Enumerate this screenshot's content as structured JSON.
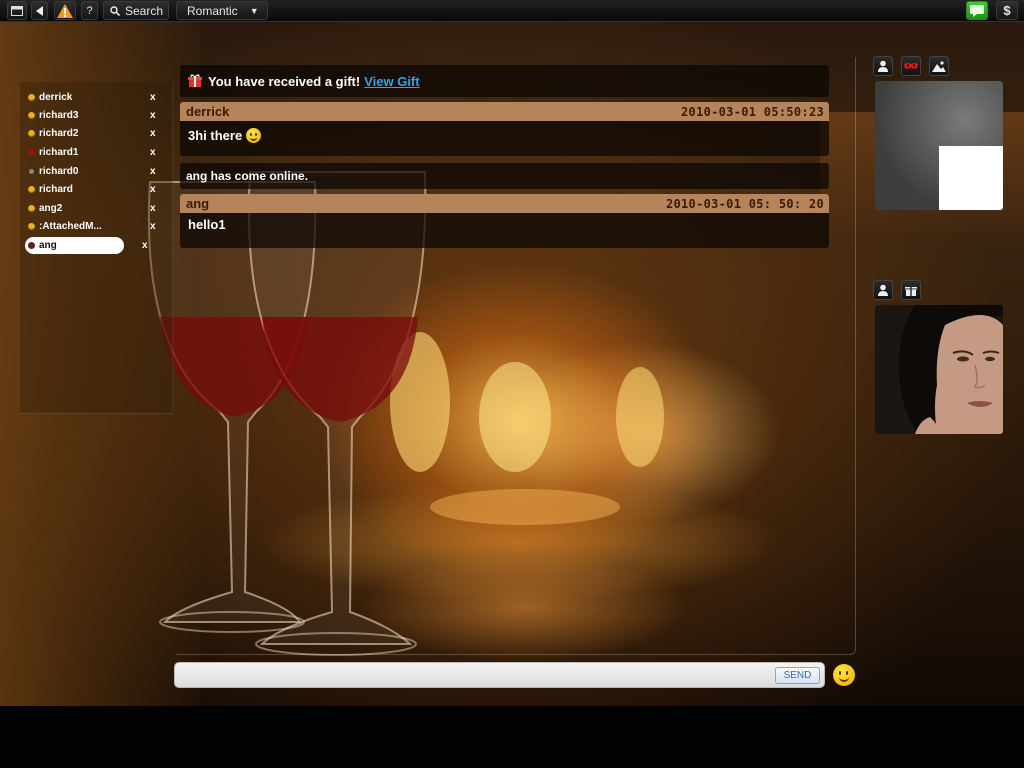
{
  "toolbar": {
    "search_label": "Search",
    "theme_label": "Romantic",
    "help_label": "?",
    "dollar_label": "$"
  },
  "contacts": [
    {
      "name": "derrick",
      "status": "yellow",
      "remove": "x"
    },
    {
      "name": "richard3",
      "status": "yellow",
      "remove": "x"
    },
    {
      "name": "richard2",
      "status": "yellow",
      "remove": "x"
    },
    {
      "name": "richard1",
      "status": "red",
      "remove": "x"
    },
    {
      "name": "richard0",
      "status": "grey",
      "remove": "x"
    },
    {
      "name": "richard",
      "status": "yellow",
      "remove": "x"
    },
    {
      "name": "ang2",
      "status": "yellow",
      "remove": "x"
    },
    {
      "name": ":AttachedM...",
      "status": "yellow",
      "remove": "x"
    },
    {
      "name": "ang",
      "status": "dark",
      "remove": "x",
      "selected": true
    }
  ],
  "chat": {
    "gift_text": "You have received a gift!",
    "gift_link": "View Gift",
    "messages": [
      {
        "sender": "derrick",
        "timestamp": "2010-03-01 05:50:23",
        "text": "3hi there"
      },
      {
        "sender": "ang",
        "timestamp": "2010-03-01 05: 50: 20",
        "text": "hello1"
      }
    ],
    "status_line": "ang has come online."
  },
  "composer": {
    "input_value": "",
    "send_label": "SEND"
  },
  "colors": {
    "header_bar": "#b5845a",
    "link": "#36a3e8",
    "status_online": "#e8b417",
    "status_busy": "#9d1010",
    "chat_button": "#3ecf2e"
  }
}
